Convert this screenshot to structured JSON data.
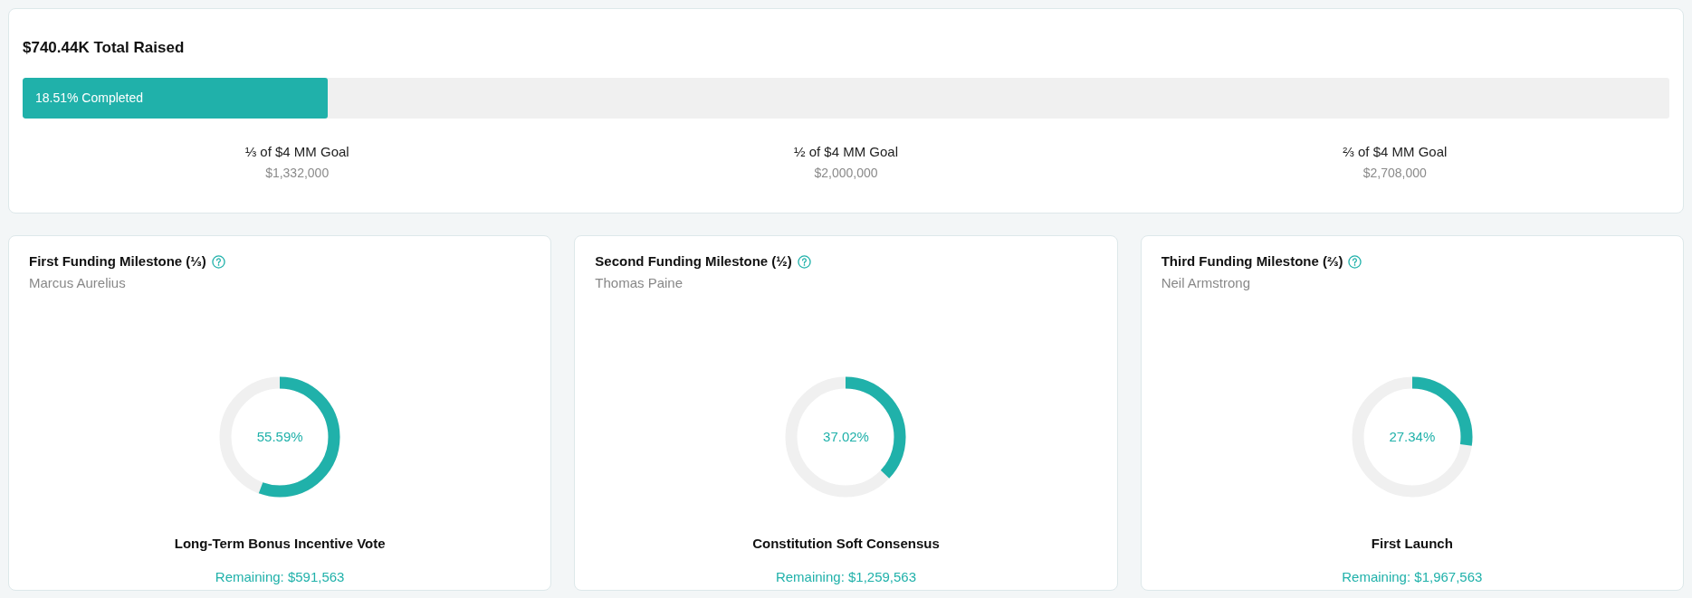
{
  "summary": {
    "title": "$740.44K Total Raised",
    "progress": {
      "label": "18.51% Completed",
      "level": 0.1851
    },
    "goals": [
      {
        "label": "⅓ of $4 MM Goal",
        "amount": "$1,332,000"
      },
      {
        "label": "½ of $4 MM Goal",
        "amount": "$2,000,000"
      },
      {
        "label": "⅔ of $4 MM Goal",
        "amount": "$2,708,000"
      }
    ]
  },
  "milestones": [
    {
      "title": "First Funding Milestone (⅓)",
      "person": "Marcus Aurelius",
      "level": 0.5559,
      "percent": "55.59%",
      "name": "Long-Term Bonus Incentive Vote",
      "remaining": "Remaining: $591,563"
    },
    {
      "title": "Second Funding Milestone (½)",
      "person": "Thomas Paine",
      "level": 0.3702,
      "percent": "37.02%",
      "name": "Constitution Soft Consensus",
      "remaining": "Remaining: $1,259,563"
    },
    {
      "title": "Third Funding Milestone (⅔)",
      "person": "Neil Armstrong",
      "level": 0.2734,
      "percent": "27.34%",
      "name": "First Launch",
      "remaining": "Remaining: $1,967,563"
    }
  ]
}
